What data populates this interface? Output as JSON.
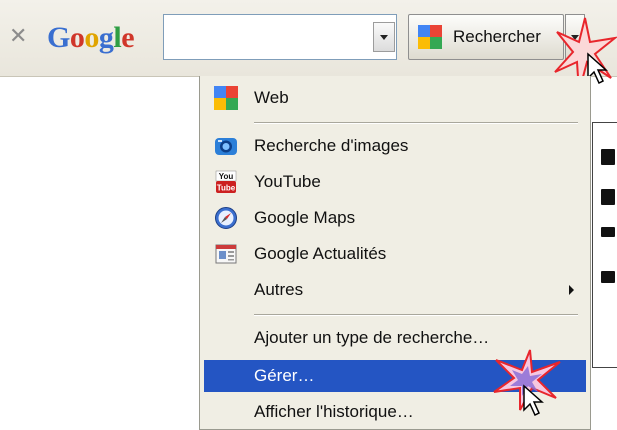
{
  "toolbar": {
    "close_icon": "✕",
    "logo_letters": [
      {
        "ch": "G",
        "color": "#3a6fd0"
      },
      {
        "ch": "o",
        "color": "#d0362a"
      },
      {
        "ch": "o",
        "color": "#e0a400"
      },
      {
        "ch": "g",
        "color": "#3a6fd0"
      },
      {
        "ch": "l",
        "color": "#2f9e44"
      },
      {
        "ch": "e",
        "color": "#d0362a"
      }
    ],
    "search_value": "",
    "search_button_label": "Rechercher"
  },
  "menu": {
    "items": [
      {
        "label": "Web",
        "icon": "google-web-icon"
      },
      {
        "label": "Recherche d'images",
        "icon": "camera-icon"
      },
      {
        "label": "YouTube",
        "icon": "youtube-icon"
      },
      {
        "label": "Google Maps",
        "icon": "compass-icon"
      },
      {
        "label": "Google Actualités",
        "icon": "news-icon"
      },
      {
        "label": "Autres",
        "icon": "",
        "submenu": true
      },
      {
        "label": "Ajouter un type de recherche…",
        "icon": ""
      },
      {
        "label": "Gérer…",
        "icon": "",
        "highlighted": true
      },
      {
        "label": "Afficher l'historique…",
        "icon": ""
      }
    ]
  },
  "colors": {
    "highlight": "#2455c3",
    "star_red": "#e8262c"
  }
}
